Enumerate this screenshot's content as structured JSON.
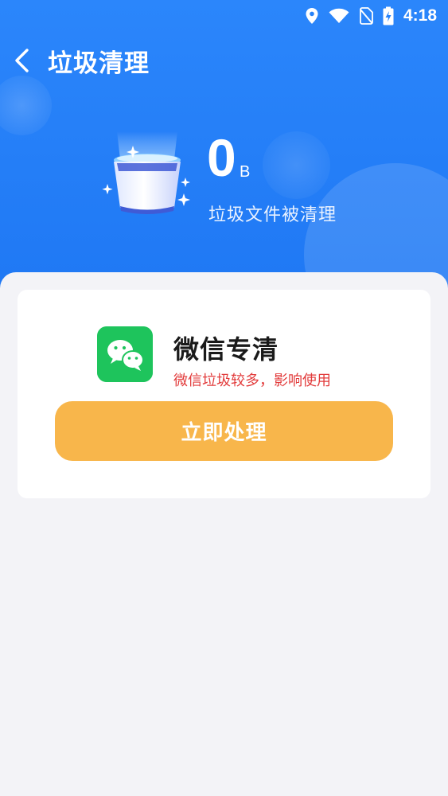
{
  "status_bar": {
    "time": "4:18"
  },
  "header": {
    "title": "垃圾清理"
  },
  "summary": {
    "size_value": "0",
    "size_unit": "B",
    "caption": "垃圾文件被清理"
  },
  "wechat_card": {
    "title": "微信专清",
    "subtitle": "微信垃圾较多，影响使用",
    "action_label": "立即处理"
  },
  "colors": {
    "header_blue": "#1f78f4",
    "button_orange": "#f8b64b",
    "warning_red": "#e23b3b",
    "wechat_green": "#1ec45c"
  },
  "icons": [
    "location-icon",
    "wifi-icon",
    "no-sim-icon",
    "battery-charging-icon",
    "back-icon",
    "trash-bin-icon",
    "wechat-icon"
  ]
}
